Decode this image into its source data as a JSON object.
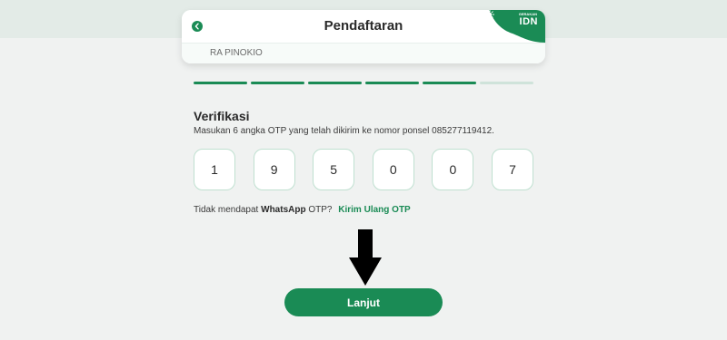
{
  "header": {
    "title": "Pendaftaran",
    "school": "RA PINOKIO",
    "brand": {
      "label": "IDN",
      "tagline": "GERAKAN",
      "color": "#1a8b55"
    }
  },
  "progress": {
    "completed": 5,
    "total": 6
  },
  "verification": {
    "title": "Verifikasi",
    "description": "Masukan 6 angka OTP yang telah dikirim ke nomor ponsel 085277119412.",
    "otp_digits": [
      "1",
      "9",
      "5",
      "0",
      "0",
      "7"
    ]
  },
  "resend": {
    "prefix": "Tidak mendapat",
    "channel": "WhatsApp",
    "suffix": "OTP?",
    "link_label": "Kirim Ulang OTP"
  },
  "actions": {
    "next_label": "Lanjut"
  },
  "colors": {
    "accent": "#1a8b55",
    "background": "#f0f2f1"
  },
  "icons": {
    "back": "chevron-left-icon",
    "annotation": "arrow-down-icon"
  }
}
